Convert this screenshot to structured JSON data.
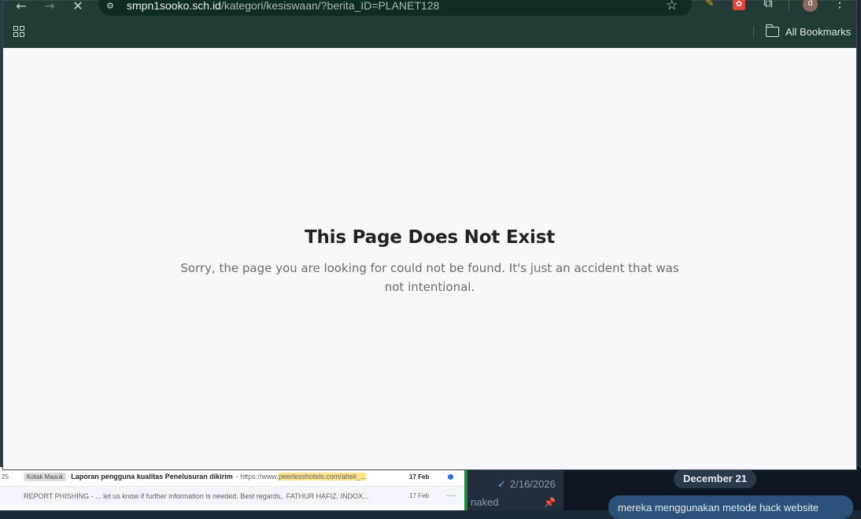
{
  "browser": {
    "url_host": "smpn1sooko.sch.id",
    "url_path": "/kategori/kesiswaan/?berita_ID=PLANET128",
    "avatar_letter": "d",
    "bookmarks_label": "All Bookmarks",
    "icons": {
      "back": "back-arrow-icon",
      "forward": "forward-arrow-icon",
      "stop": "stop-loading-icon",
      "site_info": "site-info-icon",
      "star": "star-icon",
      "apps": "apps-grid-icon",
      "folder": "folder-icon",
      "menu": "kebab-menu-icon"
    }
  },
  "page": {
    "title": "This Page Does Not Exist",
    "message": "Sorry, the page you are looking for could not be found. It's just an accident that was not intentional."
  },
  "background": {
    "mail": {
      "rows": [
        {
          "num": "25",
          "tag": "Kotak Masuk",
          "subject": "Laporan pengguna kualitas Penelusuran dikirim",
          "snippet_prefix": " - https://www.",
          "snippet_highlight": "peerlesshotels.com/aheli_...",
          "date": "17 Feb"
        },
        {
          "num": "",
          "tag": "",
          "subject": "",
          "snippet_prefix": "REPORT PHISHING - ... let us know if further information is needed. Best regards,. FATHUR HAFIZ. INDOX...",
          "snippet_highlight": "",
          "date": "17 Feb"
        }
      ]
    },
    "chat_list": {
      "date": "2/16/2026",
      "name": "naked"
    },
    "chat_view": {
      "day": "December 21",
      "bubble": "mereka menggunakan metode hack website"
    },
    "colors": {
      "browser_frame": "#223b36",
      "omnibox": "#0f2b26",
      "page_bg": "#f7f7fc",
      "title": "#1f2328",
      "message": "#6b6b73",
      "chat_bubble": "#2b5278"
    }
  }
}
